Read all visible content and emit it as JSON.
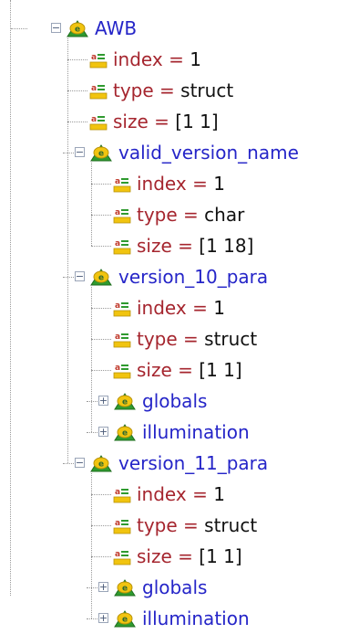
{
  "tree": {
    "root": {
      "name": "AWB",
      "attrs": [
        {
          "key": "index",
          "eq": " = ",
          "value": "1"
        },
        {
          "key": "type",
          "eq": " = ",
          "value": "struct"
        },
        {
          "key": "size",
          "eq": " = ",
          "value": "[1 1]"
        }
      ],
      "children": [
        {
          "name": "valid_version_name",
          "expanded": true,
          "attrs": [
            {
              "key": "index",
              "eq": " = ",
              "value": "1"
            },
            {
              "key": "type",
              "eq": " = ",
              "value": "char"
            },
            {
              "key": "size",
              "eq": " = ",
              "value": "[1 18]"
            }
          ],
          "children": []
        },
        {
          "name": "version_10_para",
          "expanded": true,
          "attrs": [
            {
              "key": "index",
              "eq": " = ",
              "value": "1"
            },
            {
              "key": "type",
              "eq": " = ",
              "value": "struct"
            },
            {
              "key": "size",
              "eq": " = ",
              "value": "[1 1]"
            }
          ],
          "children": [
            {
              "name": "globals",
              "expanded": false
            },
            {
              "name": "illumination",
              "expanded": false
            }
          ]
        },
        {
          "name": "version_11_para",
          "expanded": true,
          "attrs": [
            {
              "key": "index",
              "eq": " = ",
              "value": "1"
            },
            {
              "key": "type",
              "eq": " = ",
              "value": "struct"
            },
            {
              "key": "size",
              "eq": " = ",
              "value": "[1 1]"
            }
          ],
          "children": [
            {
              "name": "globals",
              "expanded": false
            },
            {
              "name": "illumination",
              "expanded": false
            }
          ]
        }
      ]
    },
    "icons": {
      "struct": "struct-node-icon",
      "attr": "attribute-icon",
      "expand": "expand-icon",
      "collapse": "collapse-icon"
    },
    "colors": {
      "struct_text": "#2525c8",
      "attr_key": "#a5252e",
      "attr_value": "#111111",
      "connector": "#9a9a9a",
      "icon_green": "#2f9a2f",
      "icon_yellow": "#f1c40f"
    }
  }
}
